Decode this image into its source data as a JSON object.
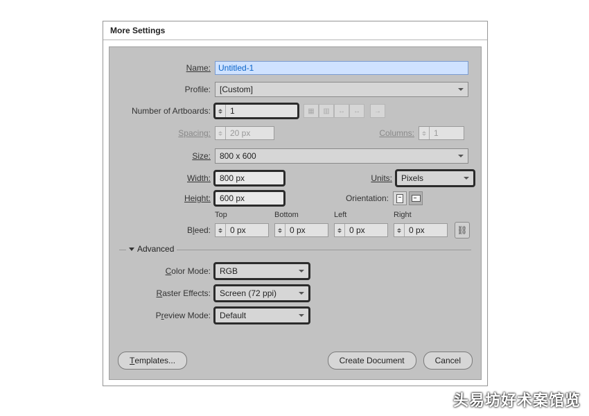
{
  "window": {
    "title": "More Settings"
  },
  "labels": {
    "name": "Name:",
    "profile": "Profile:",
    "artboards": "Number of Artboards:",
    "spacing": "Spacing:",
    "columns": "Columns:",
    "size": "Size:",
    "width": "Width:",
    "height": "Height:",
    "units": "Units:",
    "orientation": "Orientation:",
    "bleed": "Bleed:",
    "top": "Top",
    "bottom": "Bottom",
    "left": "Left",
    "right": "Right",
    "advanced": "Advanced",
    "color_mode": "Color Mode:",
    "raster": "Raster Effects:",
    "preview": "Preview Mode:"
  },
  "values": {
    "name": "Untitled-1",
    "profile": "[Custom]",
    "artboards": "1",
    "spacing": "20 px",
    "columns": "1",
    "size": "800 x 600",
    "width": "800 px",
    "height": "600 px",
    "units": "Pixels",
    "bleed_top": "0 px",
    "bleed_bottom": "0 px",
    "bleed_left": "0 px",
    "bleed_right": "0 px",
    "color_mode": "RGB",
    "raster": "Screen (72 ppi)",
    "preview": "Default"
  },
  "buttons": {
    "templates": "Templates...",
    "create": "Create Document",
    "cancel": "Cancel"
  },
  "watermark": "头易坊好术案馆览"
}
